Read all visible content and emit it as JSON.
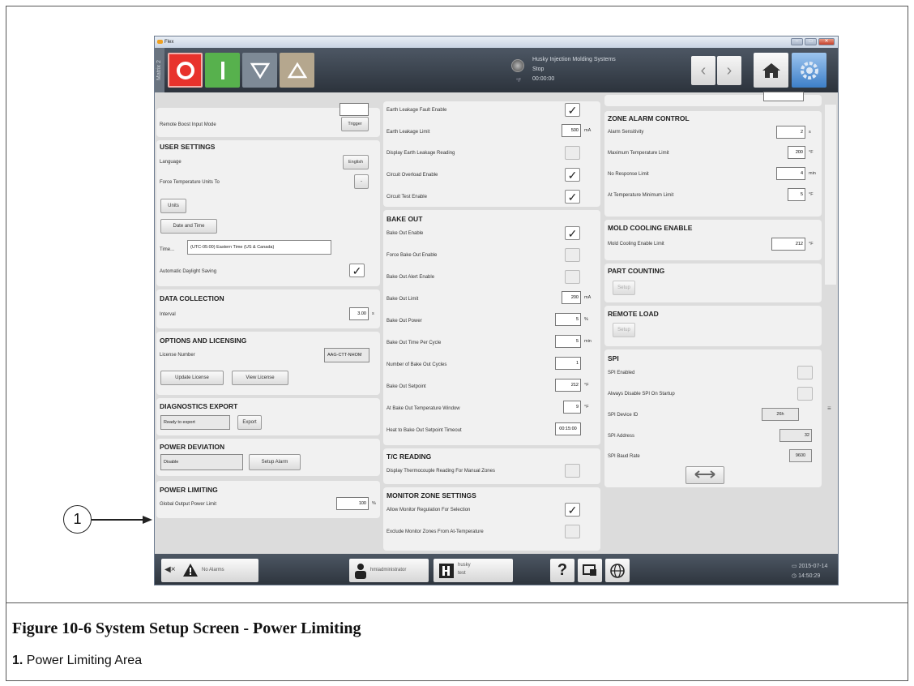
{
  "window": {
    "title": "Flex",
    "min": "–",
    "max": "□",
    "close": "✕"
  },
  "topbar": {
    "matrix": "Matrix 2",
    "company": "Husky Injection Molding Systems",
    "status": "Stop",
    "time": "00:00:00",
    "unit": "°F"
  },
  "left": {
    "remote_boost_label": "Remote Boost Input Mode",
    "remote_boost_value": "Trigger",
    "user_settings": "USER SETTINGS",
    "language_label": "Language",
    "language_value": "English",
    "force_temp_label": "Force Temperature Units To",
    "force_temp_value": "-",
    "units_btn": "Units",
    "datetime_btn": "Date and Time",
    "time_btn": "Time...",
    "timezone": "(UTC-05:00) Eastern Time (US & Canada)",
    "daylight_label": "Automatic Daylight Saving",
    "data_collection": "DATA COLLECTION",
    "interval_label": "Interval",
    "interval_value": "3.00",
    "interval_unit": "s",
    "options": "OPTIONS AND LICENSING",
    "license_label": "License Number",
    "license_value": "AAG-CTT-NHOM",
    "update_license": "Update License",
    "view_license": "View License",
    "diag": "DIAGNOSTICS EXPORT",
    "diag_status": "Ready to export",
    "export_btn": "Export",
    "power_dev": "POWER DEVIATION",
    "power_dev_value": "Disable",
    "setup_alarm": "Setup Alarm",
    "power_limiting": "POWER LIMITING",
    "global_label": "Global Output Power Limit",
    "global_value": "100",
    "global_unit": "%"
  },
  "middle": {
    "earth_fault": "Earth Leakage Fault Enable",
    "earth_limit": "Earth Leakage Limit",
    "earth_limit_value": "500",
    "earth_limit_unit": "mA",
    "display_earth": "Display Earth Leakage Reading",
    "circuit_overload": "Circuit Overload Enable",
    "circuit_test": "Circuit Test Enable",
    "bake_out": "BAKE OUT",
    "bake_enable": "Bake Out Enable",
    "force_bake": "Force Bake Out Enable",
    "bake_alert": "Bake Out Alert Enable",
    "bake_limit": "Bake Out Limit",
    "bake_limit_value": "200",
    "bake_limit_unit": "mA",
    "bake_power": "Bake Out Power",
    "bake_power_value": "5",
    "bake_power_unit": "%",
    "bake_time": "Bake Out Time Per Cycle",
    "bake_time_value": "5",
    "bake_time_unit": "min",
    "bake_cycles": "Number of Bake Out Cycles",
    "bake_cycles_value": "1",
    "bake_setpoint": "Bake Out Setpoint",
    "bake_setpoint_value": "212",
    "bake_setpoint_unit": "°F",
    "bake_window": "At Bake Out Temperature Window",
    "bake_window_value": "9",
    "bake_window_unit": "°F",
    "heat_timeout": "Heat to Bake Out Setpoint Timeout",
    "heat_timeout_value": "00:15:00",
    "tc_reading": "T/C READING",
    "tc_display": "Display Thermocouple Reading For Manual Zones",
    "monitor": "MONITOR ZONE SETTINGS",
    "monitor_allow": "Allow Monitor Regulation For Selection",
    "monitor_exclude": "Exclude Monitor Zones From At-Temperature"
  },
  "right": {
    "zone_alarm": "ZONE ALARM CONTROL",
    "alarm_sens": "Alarm Sensitivity",
    "alarm_sens_value": "2",
    "alarm_sens_unit": "s",
    "max_temp": "Maximum Temperature Limit",
    "max_temp_value": "200",
    "max_temp_unit": "°F",
    "no_resp": "No Response Limit",
    "no_resp_value": "4",
    "no_resp_unit": "min",
    "at_temp": "At Temperature Minimum Limit",
    "at_temp_value": "5",
    "at_temp_unit": "°F",
    "mold_cooling": "MOLD COOLING ENABLE",
    "mold_limit": "Mold Cooling Enable Limit",
    "mold_limit_value": "212",
    "mold_limit_unit": "°F",
    "part_counting": "PART COUNTING",
    "setup_btn": "Setup",
    "remote_load": "REMOTE LOAD",
    "setup_btn2": "Setup",
    "spi": "SPI",
    "spi_enabled": "SPI Enabled",
    "spi_disable": "Always Disable SPI On Startup",
    "spi_device": "SPI Device ID",
    "spi_device_value": "26h",
    "spi_address": "SPI Address",
    "spi_address_value": "32",
    "spi_baud": "SPI Baud Rate",
    "spi_baud_value": "9600"
  },
  "bottombar": {
    "alarms": "No Alarms",
    "user": "hmiadministrator",
    "company": "husky",
    "company_sub": "test",
    "date": "2015-07-14",
    "clock": "14:50:29"
  },
  "callout": {
    "number": "1"
  },
  "caption": {
    "title": "Figure 10-6 System Setup Screen - Power Limiting",
    "note_num": "1.",
    "note_text": "Power Limiting Area"
  },
  "colors": {
    "red": "#e8322c",
    "green": "#57b14d",
    "bar": "#3a424c"
  }
}
